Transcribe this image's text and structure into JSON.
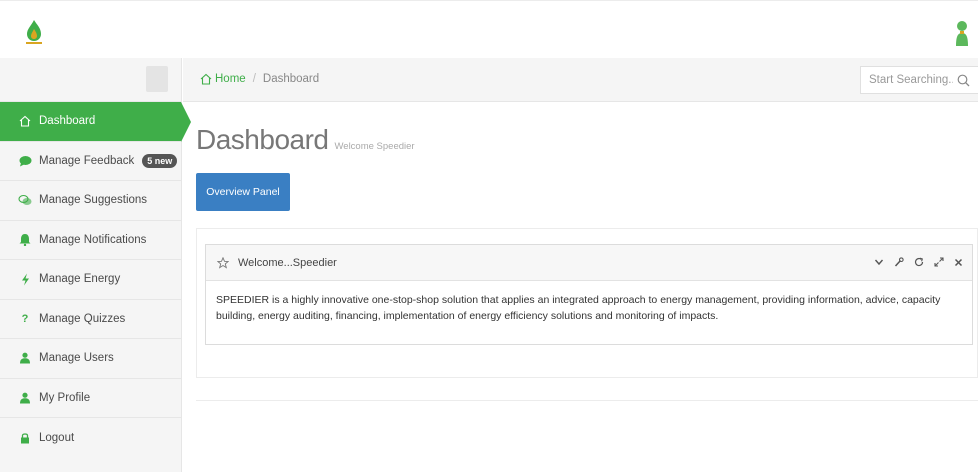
{
  "header": {
    "logo_icon": "flame-logo-icon",
    "user_icon": "user-icon"
  },
  "sidebar": {
    "items": [
      {
        "label": "Dashboard",
        "icon": "home-icon",
        "active": true
      },
      {
        "label": "Manage Feedback",
        "icon": "chat-bubble-icon",
        "badge": "5 new"
      },
      {
        "label": "Manage Suggestions",
        "icon": "chat-bubbles-icon"
      },
      {
        "label": "Manage Notifications",
        "icon": "bell-icon"
      },
      {
        "label": "Manage Energy",
        "icon": "bolt-icon"
      },
      {
        "label": "Manage Quizzes",
        "icon": "question-icon"
      },
      {
        "label": "Manage Users",
        "icon": "users-icon"
      },
      {
        "label": "My Profile",
        "icon": "user-icon"
      },
      {
        "label": "Logout",
        "icon": "lock-icon"
      }
    ]
  },
  "breadcrumb": {
    "home": "Home",
    "separator": "/",
    "current": "Dashboard"
  },
  "search": {
    "placeholder": "Start Searching..."
  },
  "page": {
    "title": "Dashboard",
    "subtitle": "Welcome Speedier"
  },
  "buttons": {
    "overview_panel": "Overview Panel"
  },
  "widget": {
    "title": "Welcome...Speedier",
    "body": "SPEEDIER is a highly innovative one-stop-shop solution that applies an integrated approach to energy management, providing information, advice, capacity building, energy auditing, financing, implementation of energy efficiency solutions and monitoring of impacts.",
    "tools": [
      "chevron-down-icon",
      "wrench-icon",
      "refresh-icon",
      "expand-icon",
      "close-icon"
    ]
  },
  "colors": {
    "accent_green": "#3fae49",
    "button_blue": "#3a7fc3"
  }
}
